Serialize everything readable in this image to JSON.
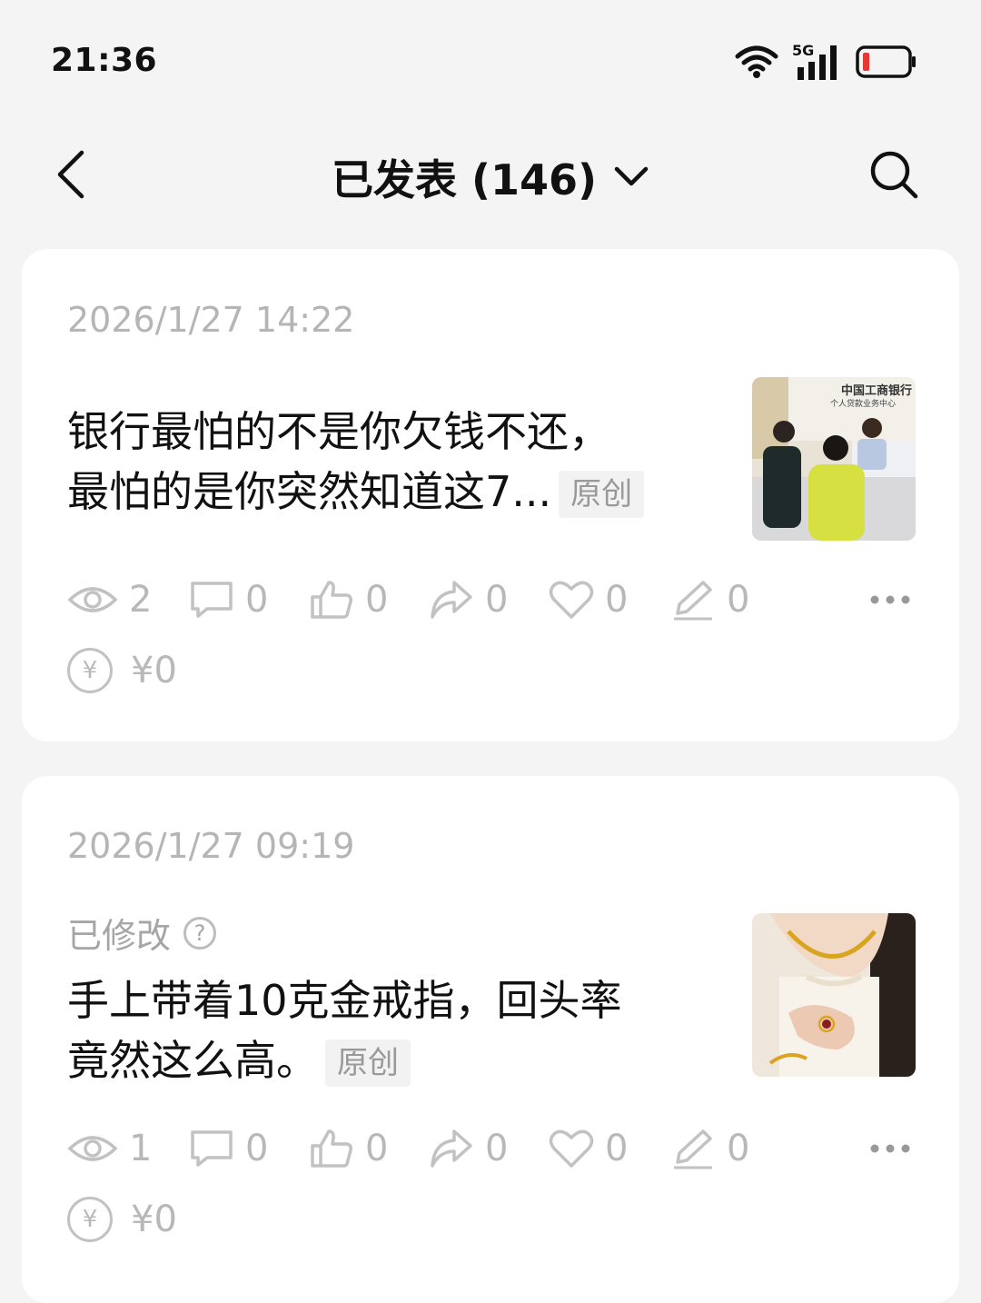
{
  "status_bar": {
    "time": "21:36",
    "network": "5G",
    "battery_color": "#e53935"
  },
  "header": {
    "title": "已发表 (146)"
  },
  "posts": [
    {
      "date": "2026/1/27 14:22",
      "modified_label": "",
      "title_line1": "银行最怕的不是你欠钱不还，",
      "title_line2": "最怕的是你突然知道这7...",
      "badge": "原创",
      "thumbnail_caption_1": "中国工商银行",
      "thumbnail_caption_2": "个人贷款业务中心",
      "stats": {
        "views": "2",
        "comments": "0",
        "likes": "0",
        "shares": "0",
        "favorites": "0",
        "edits": "0"
      },
      "income": "¥0"
    },
    {
      "date": "2026/1/27 09:19",
      "modified_label": "已修改",
      "title_line1": "手上带着10克金戒指，回头率",
      "title_line2": "竟然这么高。",
      "badge": "原创",
      "stats": {
        "views": "1",
        "comments": "0",
        "likes": "0",
        "shares": "0",
        "favorites": "0",
        "edits": "0"
      },
      "income": "¥0"
    }
  ],
  "icons": {
    "yen_symbol": "¥",
    "help_symbol": "?"
  }
}
